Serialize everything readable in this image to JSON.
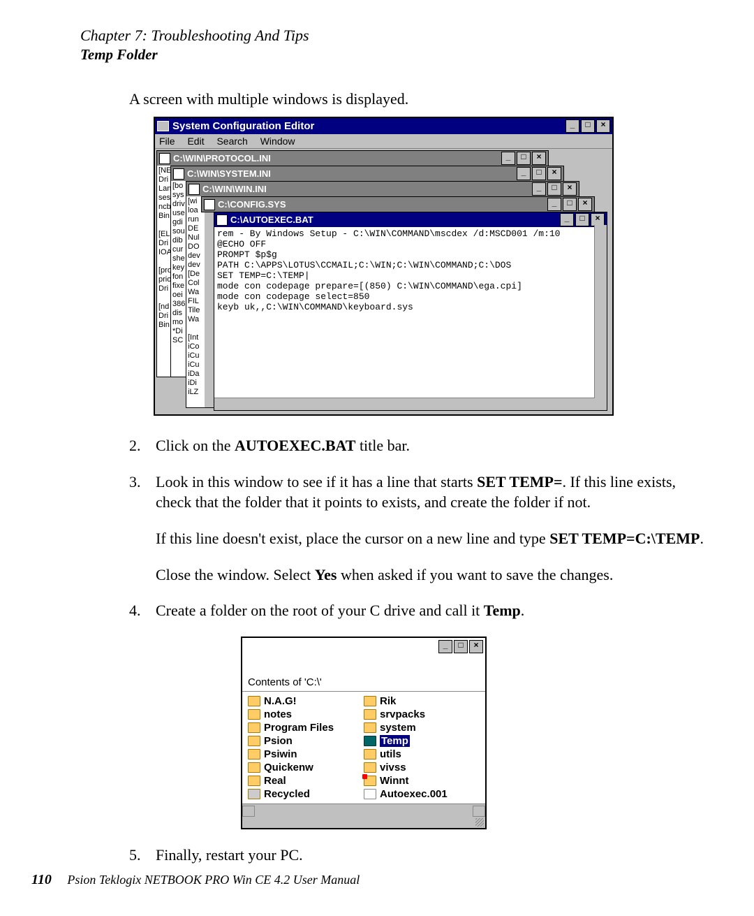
{
  "header": {
    "chapter": "Chapter 7:  Troubleshooting And Tips",
    "section": "Temp Folder"
  },
  "intro": "A screen with multiple windows is displayed.",
  "sysconfig": {
    "title": "System Configuration Editor",
    "menu": {
      "file": "File",
      "edit": "Edit",
      "search": "Search",
      "window": "Window"
    },
    "windows": {
      "protocol": "C:\\WIN\\PROTOCOL.INI",
      "system": "C:\\WIN\\SYSTEM.INI",
      "winini": "C:\\WIN\\WIN.INI",
      "config": "C:\\CONFIG.SYS",
      "autoexec": "C:\\AUTOEXEC.BAT"
    },
    "autoexec_lines": "rem - By Windows Setup - C:\\WIN\\COMMAND\\mscdex /d:MSCD001 /m:10\n@ECHO OFF\nPROMPT $p$g\nPATH C:\\APPS\\LOTUS\\CCMAIL;C:\\WIN;C:\\WIN\\COMMAND;C:\\DOS\nSET TEMP=C:\\TEMP|\nmode con codepage prepare=[(850) C:\\WIN\\COMMAND\\ega.cpi]\nmode con codepage select=850\nkeyb uk,,C:\\WIN\\COMMAND\\keyboard.sys",
    "bg_protocol": "[NE\nDri\nLan\nses\nncb\nBin\n\n[EL\nDri\nIOA\n\n[pro\nprio\nDri\n\n[nd\nDri\nBin",
    "bg_system": "[bo\nsys\ndriv\nuse\ngdi\nsou\ndib\ncur\nshe\nkey\nfon\nfixe\noei\n386\ndis\nmo\n*Di\nSC",
    "bg_winini": "[wi\nloa\nrun\nDE\nNul\nDO\ndev\ndev\n[De\nCol\nWa\nFIL\nTile\nWa\n\n[Int\niCo\niCu\niCu\niDa\niDi\niLZ"
  },
  "steps": {
    "s2_num": "2.",
    "s2_a": "Click on the ",
    "s2_b": "AUTOEXEC.BAT",
    "s2_c": " title bar.",
    "s3_num": "3.",
    "s3_a": "Look in this window to see if it has a line that starts ",
    "s3_b": "SET TEMP=",
    "s3_c": ". If this line exists, check that the folder that it points to exists, and create the folder if not.",
    "s3_d": "If this line doesn't exist, place the cursor on a new line and type ",
    "s3_e": "SET TEMP=C:\\TEMP",
    "s3_f": ".",
    "s3_g": "Close the window. Select ",
    "s3_h": "Yes",
    "s3_i": " when asked if you want to save the changes.",
    "s4_num": "4.",
    "s4_a": "Create a folder on the root of your C drive and call it ",
    "s4_b": "Temp",
    "s4_c": ".",
    "s5_num": "5.",
    "s5_a": "Finally, restart your PC."
  },
  "explorer": {
    "label": "Contents of 'C:\\'",
    "col1": [
      "N.A.G!",
      "notes",
      "Program Files",
      "Psion",
      "Psiwin",
      "Quickenw",
      "Real",
      "Recycled"
    ],
    "col2": [
      "Rik",
      "srvpacks",
      "system",
      "Temp",
      "utils",
      "vivss",
      "Winnt",
      "Autoexec.001"
    ]
  },
  "footer": {
    "page": "110",
    "manual": "Psion Teklogix NETBOOK PRO Win CE 4.2 User Manual"
  }
}
